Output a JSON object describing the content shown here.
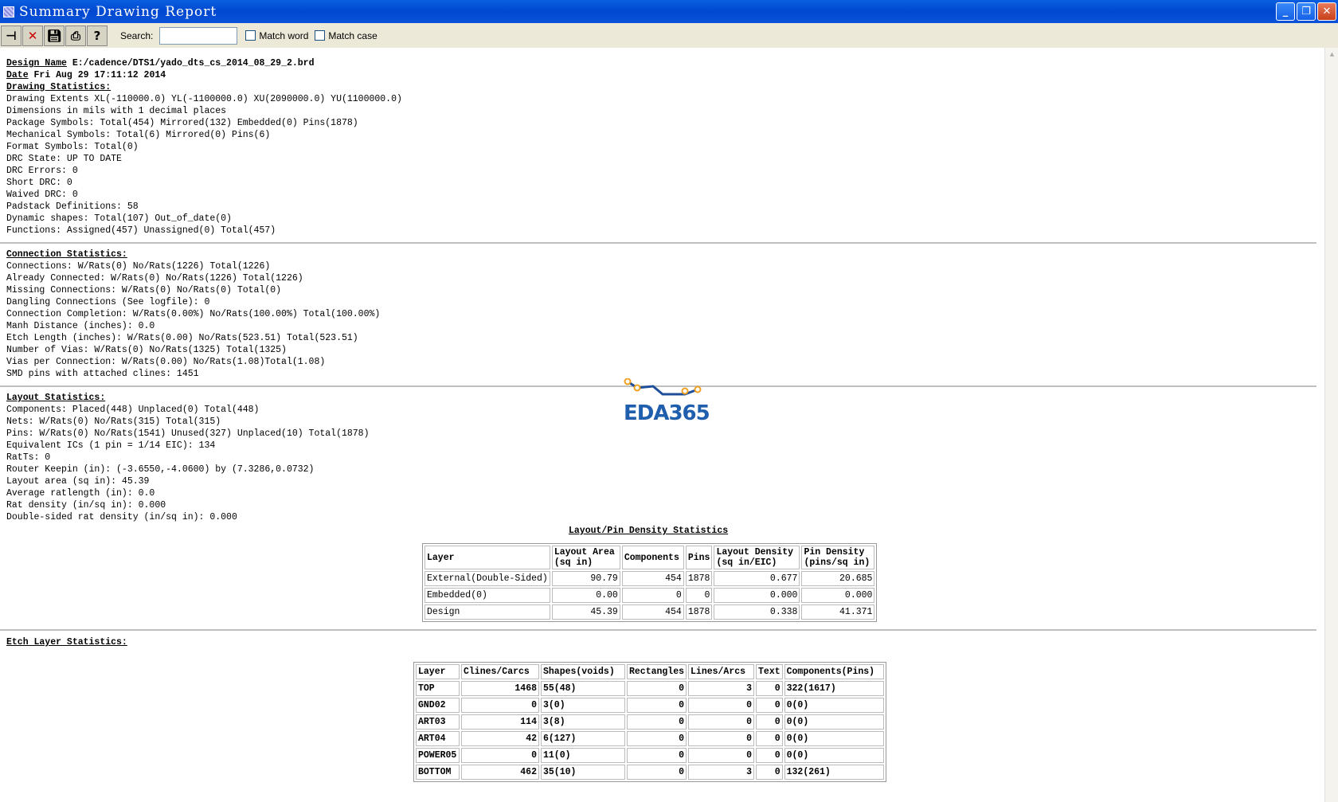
{
  "window": {
    "title": "Summary Drawing Report"
  },
  "toolbar": {
    "search_label": "Search:",
    "search_value": "",
    "match_word": "Match word",
    "match_case": "Match case"
  },
  "header": {
    "design_label": "Design Name",
    "design_value": "E:/cadence/DTS1/yado_dts_cs_2014_08_29_2.brd",
    "date_label": "Date",
    "date_value": "Fri Aug 29 17:11:12 2014"
  },
  "drawing": {
    "heading": "Drawing Statistics:",
    "lines": [
      "Drawing Extents XL(-110000.0) YL(-1100000.0) XU(2090000.0) YU(1100000.0)",
      "Dimensions in mils with 1 decimal places",
      "Package Symbols: Total(454) Mirrored(132) Embedded(0) Pins(1878)",
      "Mechanical Symbols: Total(6) Mirrored(0) Pins(6)",
      "Format Symbols: Total(0)",
      "DRC State: UP TO DATE",
      "DRC Errors: 0",
      "Short DRC: 0",
      "Waived DRC: 0",
      "Padstack Definitions: 58",
      "Dynamic shapes: Total(107) Out_of_date(0)",
      "Functions: Assigned(457) Unassigned(0) Total(457)"
    ]
  },
  "connection": {
    "heading": "Connection Statistics:",
    "lines": [
      "Connections: W/Rats(0) No/Rats(1226) Total(1226)",
      "Already Connected: W/Rats(0) No/Rats(1226) Total(1226)",
      "Missing Connections: W/Rats(0) No/Rats(0) Total(0)",
      "Dangling Connections (See logfile): 0",
      "Connection Completion: W/Rats(0.00%) No/Rats(100.00%) Total(100.00%)",
      "Manh Distance (inches): 0.0",
      "Etch Length (inches): W/Rats(0.00) No/Rats(523.51) Total(523.51)",
      "Number of Vias: W/Rats(0) No/Rats(1325) Total(1325)",
      "Vias per Connection: W/Rats(0.00) No/Rats(1.08)Total(1.08)",
      "SMD pins with attached clines: 1451"
    ]
  },
  "layout": {
    "heading": "Layout Statistics:",
    "lines": [
      "Components: Placed(448) Unplaced(0) Total(448)",
      "Nets: W/Rats(0) No/Rats(315) Total(315)",
      "Pins: W/Rats(0) No/Rats(1541) Unused(327) Unplaced(10) Total(1878)",
      "Equivalent ICs (1 pin = 1/14 EIC): 134",
      "RatTs: 0",
      "Router Keepin (in): (-3.6550,-4.0600) by (7.3286,0.0732)",
      "Layout area (sq in): 45.39",
      "Average ratlength (in): 0.0",
      "Rat density (in/sq in): 0.000",
      "Double-sided rat density (in/sq in): 0.000"
    ]
  },
  "density": {
    "title": "Layout/Pin Density Statistics",
    "headers": [
      [
        "Layer"
      ],
      [
        "Layout Area",
        "(sq in)"
      ],
      [
        "Components"
      ],
      [
        "Pins"
      ],
      [
        "Layout Density",
        "(sq in/EIC)"
      ],
      [
        "Pin Density",
        "(pins/sq in)"
      ]
    ],
    "rows": [
      [
        "External(Double-Sided)",
        "90.79",
        "454",
        "1878",
        "0.677",
        "20.685"
      ],
      [
        "Embedded(0)",
        "0.00",
        "0",
        "0",
        "0.000",
        "0.000"
      ],
      [
        "Design",
        "45.39",
        "454",
        "1878",
        "0.338",
        "41.371"
      ]
    ]
  },
  "etch": {
    "heading": "Etch Layer Statistics:",
    "headers": [
      "Layer",
      "Clines/Carcs",
      "Shapes(voids)",
      "Rectangles",
      "Lines/Arcs",
      "Text",
      "Components(Pins)"
    ],
    "rows": [
      [
        "TOP",
        "1468",
        "55(48)",
        "0",
        "3",
        "0",
        "322(1617)"
      ],
      [
        "GND02",
        "0",
        "3(0)",
        "0",
        "0",
        "0",
        "0(0)"
      ],
      [
        "ART03",
        "114",
        "3(8)",
        "0",
        "0",
        "0",
        "0(0)"
      ],
      [
        "ART04",
        "42",
        "6(127)",
        "0",
        "0",
        "0",
        "0(0)"
      ],
      [
        "POWER05",
        "0",
        "11(0)",
        "0",
        "0",
        "0",
        "0(0)"
      ],
      [
        "BOTTOM",
        "462",
        "35(10)",
        "0",
        "3",
        "0",
        "132(261)"
      ]
    ]
  },
  "watermark": {
    "text": "EDA365"
  }
}
